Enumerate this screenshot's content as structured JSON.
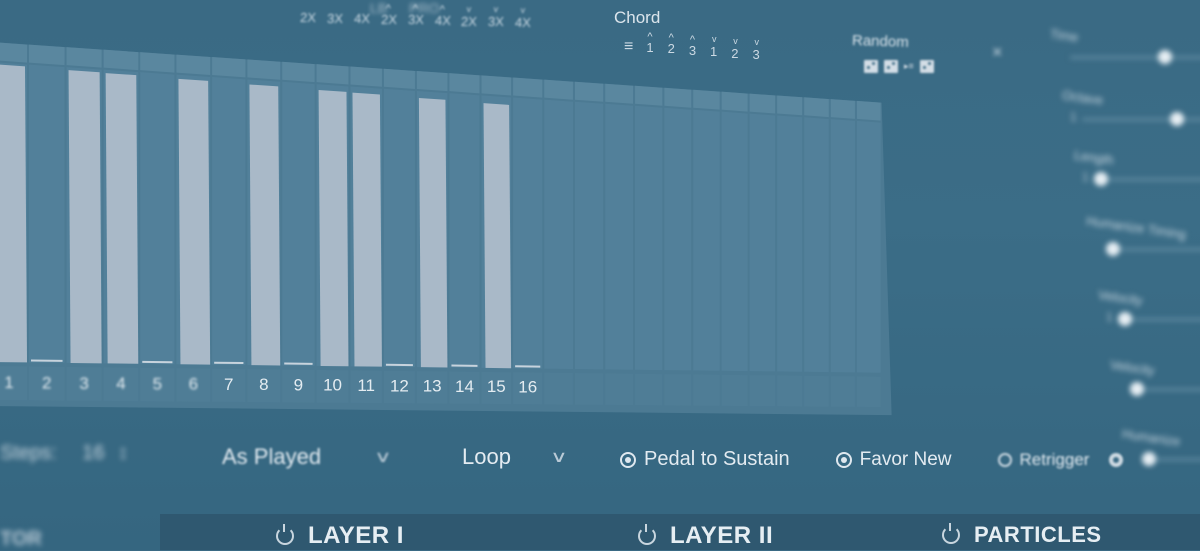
{
  "top_left_labels": [
    "LB",
    "PRO"
  ],
  "step_multipliers": [
    {
      "label": "2X",
      "mark": "none"
    },
    {
      "label": "3X",
      "mark": "none"
    },
    {
      "label": "4X",
      "mark": "none"
    },
    {
      "label": "2X",
      "mark": "up"
    },
    {
      "label": "3X",
      "mark": "up"
    },
    {
      "label": "4X",
      "mark": "up"
    },
    {
      "label": "2X",
      "mark": "down"
    },
    {
      "label": "3X",
      "mark": "down"
    },
    {
      "label": "4X",
      "mark": "down"
    }
  ],
  "chord": {
    "title": "Chord",
    "options": [
      {
        "label": "≡",
        "mark": "none",
        "icon": "list-icon"
      },
      {
        "label": "1",
        "mark": "up"
      },
      {
        "label": "2",
        "mark": "up"
      },
      {
        "label": "3",
        "mark": "up"
      },
      {
        "label": "1",
        "mark": "down"
      },
      {
        "label": "2",
        "mark": "down"
      },
      {
        "label": "3",
        "mark": "down"
      }
    ]
  },
  "random": {
    "title": "Random",
    "icons": [
      "dice-icon",
      "dice-forward-icon",
      "dice-shuffle-icon"
    ]
  },
  "close_icon": "×",
  "sequencer": {
    "step_count_visible": 16,
    "total_columns": 28,
    "step_labels": [
      "1",
      "2",
      "3",
      "4",
      "5",
      "6",
      "7",
      "8",
      "9",
      "10",
      "11",
      "12",
      "13",
      "14",
      "15",
      "16"
    ],
    "active_steps": [
      1,
      3,
      4,
      6,
      8,
      10,
      11,
      13,
      15
    ],
    "bar_color": "#a9b9c8",
    "cell_color": "#52809a"
  },
  "controls": {
    "steps_label": "Steps:",
    "steps_value": "16",
    "order_dropdown": "As Played",
    "mode_dropdown": "Loop",
    "chevron": "∨",
    "options": [
      {
        "label": "Pedal to Sustain",
        "checked": true
      },
      {
        "label": "Favor New",
        "checked": true
      },
      {
        "label": "Retrigger",
        "checked": false
      }
    ]
  },
  "right_panel": {
    "sliders": [
      {
        "label": "Time",
        "value": 0.55,
        "num": ""
      },
      {
        "label": "Octave",
        "value": 0.55,
        "num": "1"
      },
      {
        "label": "Length",
        "value": 0.0,
        "num": "1"
      },
      {
        "label": "Humanize Timing",
        "value": 0.0,
        "num": ""
      },
      {
        "label": "Velocity",
        "value": 0.0,
        "num": "1"
      },
      {
        "label": "Velocity",
        "value": 0.0,
        "num": ""
      },
      {
        "label": "Humanize",
        "value": 0.0,
        "num": ""
      }
    ]
  },
  "tabs": {
    "left_label": "TOR",
    "items": [
      {
        "label": "LAYER I"
      },
      {
        "label": "LAYER II"
      },
      {
        "label": "PARTICLES"
      }
    ]
  }
}
